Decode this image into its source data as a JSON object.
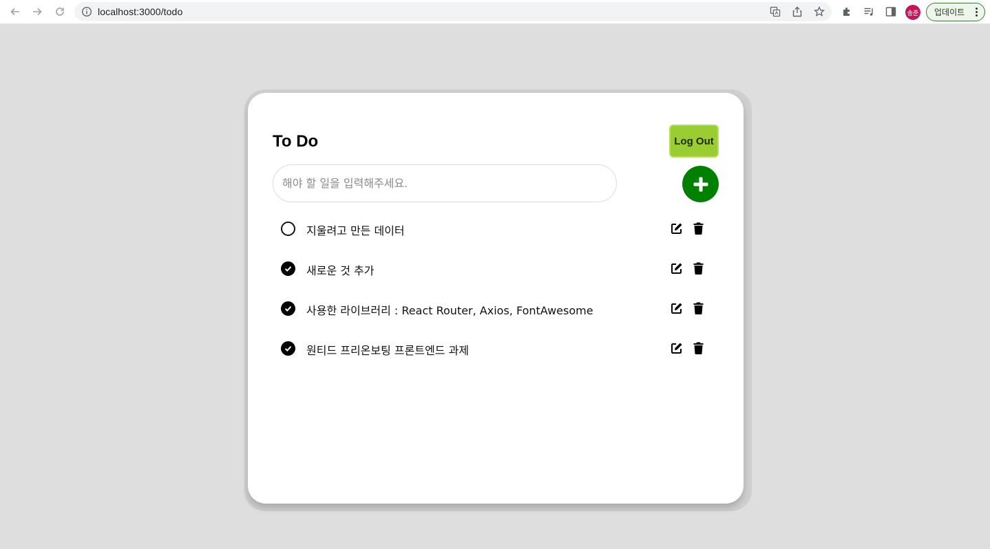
{
  "browser": {
    "url": "localhost:3000/todo",
    "profile_initials": "송준",
    "update_label": "업데이트"
  },
  "app": {
    "title": "To Do",
    "logout_label": "Log Out",
    "input_placeholder": "해야 할 일을 입력해주세요.",
    "input_value": "",
    "add_icon": "plus-icon",
    "accent_color": "#9acd32",
    "add_color": "#008000"
  },
  "todos": [
    {
      "text": "지울려고 만든 데이터",
      "done": false
    },
    {
      "text": "새로운 것 추가",
      "done": true
    },
    {
      "text": "사용한 라이브러리 : React Router, Axios, FontAwesome",
      "done": true
    },
    {
      "text": "원티드 프리온보팅 프론트엔드 과제",
      "done": true
    }
  ]
}
